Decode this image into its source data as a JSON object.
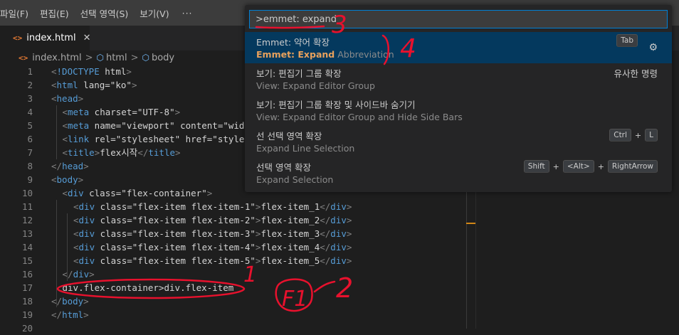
{
  "menu": {
    "items": [
      "파일(F)",
      "편집(E)",
      "선택 영역(S)",
      "보기(V)"
    ],
    "more": "···"
  },
  "tab": {
    "title": "index.html",
    "close": "✕"
  },
  "breadcrumb": {
    "file": "index.html",
    "html": "html",
    "body": "body",
    "sep": ">"
  },
  "icons": {
    "file": "html-file-icon",
    "element": "element-cube-icon",
    "settings": "gear-icon"
  },
  "colors": {
    "accent": "#007fd4",
    "selection": "#04395e",
    "highlight": "#e8a15c",
    "annotation": "#e8112d"
  },
  "palette": {
    "input_value": ">emmet: expand",
    "rows": [
      {
        "main": "Emmet: 약어 확장",
        "sub_hl": "Emmet: Expand",
        "sub_rest": " Abbreviation",
        "kbd": "Tab"
      },
      {
        "main": "보기: 편집기 그룹 확장",
        "sub": "View: Expand Editor Group",
        "note": "유사한 명령"
      },
      {
        "main": "보기: 편집기 그룹 확장 및 사이드바 숨기기",
        "sub": "View: Expand Editor Group and Hide Side Bars"
      },
      {
        "main": "선 선택 영역 확장",
        "sub": "Expand Line Selection",
        "keys": [
          "Ctrl",
          "L"
        ]
      },
      {
        "main": "선택 영역 확장",
        "sub": "Expand Selection",
        "keys": [
          "Shift",
          "<Alt>",
          "RightArrow"
        ]
      }
    ],
    "plus": "+"
  },
  "editor": {
    "line_numbers": [
      "1",
      "2",
      "3",
      "4",
      "5",
      "6",
      "7",
      "8",
      "9",
      "10",
      "11",
      "12",
      "13",
      "14",
      "15",
      "16",
      "17",
      "18",
      "19",
      "20"
    ],
    "lines": [
      "<!DOCTYPE html>",
      "<html lang=\"ko\">",
      "<head>",
      "<meta charset=\"UTF-8\">",
      "<meta name=\"viewport\" content=\"wid",
      "<link rel=\"stylesheet\" href=\"style",
      "<title>flex시작</title>",
      "</head>",
      "<body>",
      "<div class=\"flex-container\">",
      "<div class=\"flex-item flex-item-1\">flex-item_1</div>",
      "<div class=\"flex-item flex-item-2\">flex-item_2</div>",
      "<div class=\"flex-item flex-item-3\">flex-item_3</div>",
      "<div class=\"flex-item flex-item-4\">flex-item_4</div>",
      "<div class=\"flex-item flex-item-5\">flex-item_5</div>",
      "</div>",
      "div.flex-container>div.flex-item",
      "</body>",
      "</html>",
      ""
    ]
  },
  "annotations": {
    "n1": "1",
    "n2": "2",
    "n3": "3",
    "n4": "4",
    "f1": "F1"
  }
}
